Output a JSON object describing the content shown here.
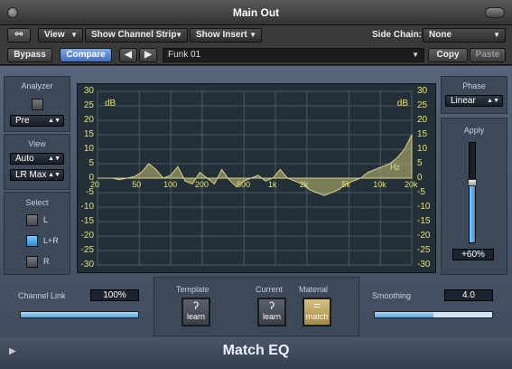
{
  "window": {
    "title": "Main Out",
    "plugin_name": "Match EQ"
  },
  "toolbar": {
    "link_icon": "link-icon",
    "view_label": "View",
    "show_channel_strip": "Show Channel Strip",
    "show_insert": "Show Insert",
    "side_chain_label": "Side Chain:",
    "side_chain_value": "None"
  },
  "toolbar2": {
    "bypass": "Bypass",
    "compare": "Compare",
    "preset": "Funk 01",
    "copy": "Copy",
    "paste": "Paste"
  },
  "analyzer": {
    "title": "Analyzer",
    "mode": "Pre"
  },
  "view": {
    "title": "View",
    "scale": "Auto",
    "channels": "LR Max"
  },
  "select": {
    "title": "Select",
    "options": [
      "L",
      "L+R",
      "R"
    ],
    "selected": "L+R"
  },
  "graph": {
    "db_unit": "dB",
    "hz_unit": "Hz",
    "db_ticks": [
      "30",
      "25",
      "20",
      "15",
      "10",
      "5",
      "0",
      "-5",
      "-10",
      "-15",
      "-20",
      "-25",
      "-30"
    ],
    "freq_ticks": [
      "20",
      "50",
      "100",
      "200",
      "500",
      "1k",
      "2k",
      "5k",
      "10k",
      "20k"
    ]
  },
  "phase": {
    "title": "Phase",
    "value": "Linear"
  },
  "apply": {
    "title": "Apply",
    "value": "+60%",
    "level": 0.6
  },
  "channel_link": {
    "title": "Channel Link",
    "value": "100%",
    "level": 1.0
  },
  "template": {
    "title": "Template",
    "button": "learn"
  },
  "current": {
    "title": "Current",
    "button": "learn"
  },
  "material": {
    "title": "Material",
    "button": "match"
  },
  "smoothing": {
    "title": "Smoothing",
    "value": "4.0",
    "level": 0.5
  },
  "colors": {
    "accent": "#5aa8e0",
    "curve": "#c8c080",
    "text_axis": "#e8e070"
  }
}
